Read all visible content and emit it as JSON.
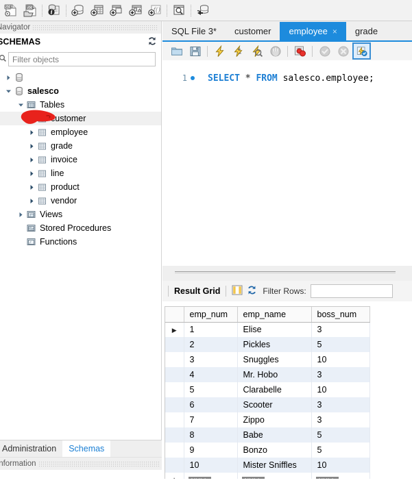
{
  "main_toolbar": {
    "buttons": [
      {
        "name": "new-sql-tab-icon",
        "title": "New SQL Tab"
      },
      {
        "name": "open-sql-script-icon",
        "title": "Open SQL Script"
      },
      {
        "name": "inspector-icon",
        "title": "Schema Inspector"
      },
      {
        "name": "create-schema-icon",
        "title": "Create New Schema"
      },
      {
        "name": "create-table-icon",
        "title": "Create New Table"
      },
      {
        "name": "create-view-icon",
        "title": "Create New View"
      },
      {
        "name": "create-procedure-icon",
        "title": "Create New Stored Procedure"
      },
      {
        "name": "create-function-icon",
        "title": "Create New Function"
      },
      {
        "name": "search-data-icon",
        "title": "Search Table Data"
      },
      {
        "name": "reconnect-server-icon",
        "title": "Reconnect to Server"
      }
    ]
  },
  "navigator": {
    "caption": "Navigator",
    "section_title": "SCHEMAS",
    "refresh_icon": "refresh-icon",
    "filter": {
      "placeholder": "Filter objects",
      "value": "",
      "icon": "filter-icon"
    },
    "tree": [
      {
        "label": "",
        "level": 0,
        "twisty": "collapsed",
        "icon": "schema-icon",
        "bold": false,
        "redacted": true
      },
      {
        "label": "salesco",
        "level": 0,
        "twisty": "expanded",
        "icon": "schema-icon",
        "bold": true
      },
      {
        "label": "Tables",
        "level": 1,
        "twisty": "expanded",
        "icon": "folder-tables-icon",
        "bold": false
      },
      {
        "label": "customer",
        "level": 2,
        "twisty": "collapsed",
        "icon": "table-icon",
        "bold": false,
        "selected": true
      },
      {
        "label": "employee",
        "level": 2,
        "twisty": "collapsed",
        "icon": "table-icon",
        "bold": false
      },
      {
        "label": "grade",
        "level": 2,
        "twisty": "collapsed",
        "icon": "table-icon",
        "bold": false
      },
      {
        "label": "invoice",
        "level": 2,
        "twisty": "collapsed",
        "icon": "table-icon",
        "bold": false
      },
      {
        "label": "line",
        "level": 2,
        "twisty": "collapsed",
        "icon": "table-icon",
        "bold": false
      },
      {
        "label": "product",
        "level": 2,
        "twisty": "collapsed",
        "icon": "table-icon",
        "bold": false
      },
      {
        "label": "vendor",
        "level": 2,
        "twisty": "collapsed",
        "icon": "table-icon",
        "bold": false
      },
      {
        "label": "Views",
        "level": 1,
        "twisty": "collapsed",
        "icon": "folder-views-icon",
        "bold": false
      },
      {
        "label": "Stored Procedures",
        "level": 1,
        "twisty": "none",
        "icon": "folder-procedures-icon",
        "bold": false
      },
      {
        "label": "Functions",
        "level": 1,
        "twisty": "none",
        "icon": "folder-functions-icon",
        "bold": false
      }
    ],
    "bottom_tabs": [
      {
        "label": "Administration",
        "active": false
      },
      {
        "label": "Schemas",
        "active": true
      }
    ],
    "information_caption": "Information"
  },
  "editor": {
    "tabs": [
      {
        "label": "SQL File 3*",
        "active": false,
        "closable": false
      },
      {
        "label": "customer",
        "active": false,
        "closable": false
      },
      {
        "label": "employee",
        "active": true,
        "closable": true,
        "close_label": "×"
      },
      {
        "label": "grade",
        "active": false,
        "closable": false
      }
    ],
    "toolbar": [
      {
        "name": "open-file-icon",
        "state": "enabled"
      },
      {
        "name": "save-file-icon",
        "state": "enabled"
      },
      {
        "name": "execute-statement-icon",
        "state": "enabled"
      },
      {
        "name": "execute-current-statement-icon",
        "state": "enabled"
      },
      {
        "name": "explain-query-icon",
        "state": "enabled"
      },
      {
        "name": "stop-execution-icon",
        "state": "disabled"
      },
      {
        "name": "toggle-stop-on-error-icon",
        "state": "enabled"
      },
      {
        "name": "commit-transaction-icon",
        "state": "disabled"
      },
      {
        "name": "rollback-transaction-icon",
        "state": "disabled"
      },
      {
        "name": "autocommit-toggle-icon",
        "state": "selected"
      }
    ],
    "code": {
      "line_number": "1",
      "breakpoint_marker": "statement-dot",
      "tokens": [
        {
          "text": "SELECT",
          "type": "keyword"
        },
        {
          "text": " ",
          "type": "plain"
        },
        {
          "text": "*",
          "type": "operator"
        },
        {
          "text": " ",
          "type": "plain"
        },
        {
          "text": "FROM",
          "type": "keyword"
        },
        {
          "text": " salesco.employee;",
          "type": "plain"
        }
      ],
      "full_text": "SELECT * FROM salesco.employee;"
    }
  },
  "results": {
    "toolbar": {
      "title": "Result Grid",
      "grid_view_icon": "grid-view-icon",
      "refresh_icon": "refresh-rows-icon",
      "filter_label": "Filter Rows:",
      "filter_value": "",
      "filter_placeholder": ""
    },
    "columns": [
      "emp_num",
      "emp_name",
      "boss_num"
    ],
    "rows": [
      {
        "marker": "▶",
        "cells": [
          "1",
          "Elise",
          "3"
        ]
      },
      {
        "marker": "",
        "cells": [
          "2",
          "Pickles",
          "5"
        ]
      },
      {
        "marker": "",
        "cells": [
          "3",
          "Snuggles",
          "10"
        ]
      },
      {
        "marker": "",
        "cells": [
          "4",
          "Mr. Hobo",
          "3"
        ]
      },
      {
        "marker": "",
        "cells": [
          "5",
          "Clarabelle",
          "10"
        ]
      },
      {
        "marker": "",
        "cells": [
          "6",
          "Scooter",
          "3"
        ]
      },
      {
        "marker": "",
        "cells": [
          "7",
          "Zippo",
          "3"
        ]
      },
      {
        "marker": "",
        "cells": [
          "8",
          "Babe",
          "5"
        ]
      },
      {
        "marker": "",
        "cells": [
          "9",
          "Bonzo",
          "5"
        ]
      },
      {
        "marker": "",
        "cells": [
          "10",
          "Mister Sniffles",
          "10"
        ]
      }
    ],
    "new_row": {
      "marker": "✱",
      "cells": [
        "NULL",
        "NULL",
        "NULL"
      ]
    }
  },
  "colors": {
    "accent_blue": "#1d8bdd",
    "keyword_blue": "#1d7fd4",
    "row_alt": "#eaf0f8",
    "annotation_red": "#e8221c",
    "panel_gray": "#efefef"
  }
}
